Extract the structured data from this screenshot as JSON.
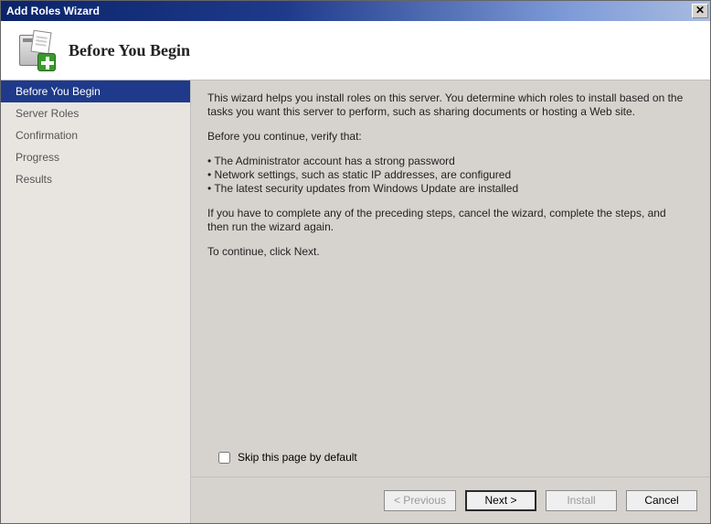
{
  "titlebar": {
    "title": "Add Roles Wizard"
  },
  "header": {
    "title": "Before You Begin"
  },
  "sidebar": {
    "items": [
      {
        "label": "Before You Begin"
      },
      {
        "label": "Server Roles"
      },
      {
        "label": "Confirmation"
      },
      {
        "label": "Progress"
      },
      {
        "label": "Results"
      }
    ]
  },
  "content": {
    "intro": "This wizard helps you install roles on this server. You determine which roles to install based on the tasks you want this server to perform, such as sharing documents or hosting a Web site.",
    "verify_heading": "Before you continue, verify that:",
    "bullets": [
      "The Administrator account has a strong password",
      "Network settings, such as static IP addresses, are configured",
      "The latest security updates from Windows Update are installed"
    ],
    "after": "If you have to complete any of the preceding steps, cancel the wizard, complete the steps, and then run the wizard again.",
    "continue": "To continue, click Next.",
    "skip_label": "Skip this page by default"
  },
  "footer": {
    "previous": "< Previous",
    "next": "Next >",
    "install": "Install",
    "cancel": "Cancel"
  }
}
